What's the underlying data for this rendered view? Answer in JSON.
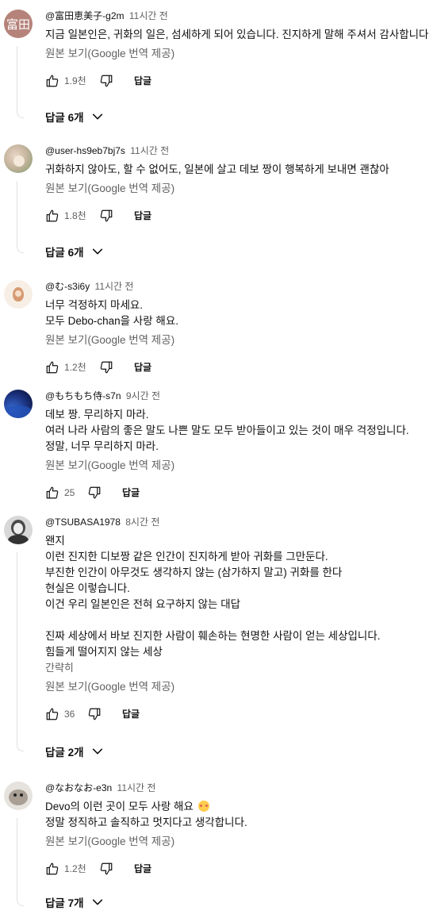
{
  "icons": {
    "like": "thumb-up-icon",
    "dislike": "thumb-down-icon",
    "chevron": "chevron-down-icon"
  },
  "colors": {
    "text": "#0f0f0f",
    "secondary": "#606060",
    "thread_line": "#e0e0e0"
  },
  "comments": [
    {
      "author": "@富田恵美子-g2m",
      "time": "11시간 전",
      "avatar_text": "富田",
      "avatar_color": "#b5837a",
      "lines": [
        "지금 일본인은, 귀화의 일은, 섬세하게 되어 있습니다. 진지하게 말해 주셔서 감사합니다"
      ],
      "translate": "원본 보기(Google 번역 제공)",
      "likes": "1.9천",
      "reply_label": "답글",
      "replies": "답글 6개"
    },
    {
      "author": "@user-hs9eb7bj7s",
      "time": "11시간 전",
      "lines": [
        "귀화하지 않아도, 할 수 없어도, 일본에 살고 데보 짱이 행복하게 보내면 괜찮아"
      ],
      "translate": "원본 보기(Google 번역 제공)",
      "likes": "1.8천",
      "reply_label": "답글",
      "replies": "답글 6개"
    },
    {
      "author": "@む-s3i6y",
      "time": "11시간 전",
      "lines": [
        "너무 걱정하지 마세요.",
        "모두 Debo-chan을 사랑 해요."
      ],
      "translate": "원본 보기(Google 번역 제공)",
      "likes": "1.2천",
      "reply_label": "답글"
    },
    {
      "author": "@もちもち侍-s7n",
      "time": "9시간 전",
      "lines": [
        "데보 짱. 무리하지 마라.",
        "여러 나라 사람의 좋은 말도 나쁜 말도 모두 받아들이고 있는 것이 매우 걱정입니다.",
        "정말, 너무 무리하지 마라."
      ],
      "translate": "원본 보기(Google 번역 제공)",
      "likes": "25",
      "reply_label": "답글"
    },
    {
      "author": "@TSUBASA1978",
      "time": "8시간 전",
      "lines": [
        "왠지",
        "이런 진지한 디보짱 같은 인간이 진지하게 받아 귀화를 그만둔다.",
        "부진한 인간이 아무것도 생각하지 않는 (삼가하지 말고) 귀화를 한다",
        "현실은 이렇습니다.",
        "이건 우리 일본인은 전혀 요구하지 않는 대답",
        "",
        "진짜 세상에서 바보 진지한 사람이 훼손하는 현명한 사람이 얻는 세상입니다.",
        "힘들게 떨어지지 않는 세상"
      ],
      "more": "간략히",
      "translate": "원본 보기(Google 번역 제공)",
      "likes": "36",
      "reply_label": "답글",
      "replies": "답글 2개"
    },
    {
      "author": "@なおなお-e3n",
      "time": "11시간 전",
      "lines": [
        "Devo의 이런 곳이 모두 사랑 해요",
        "정말 정직하고 솔직하고 멋지다고 생각합니다."
      ],
      "translate": "원본 보기(Google 번역 제공)",
      "likes": "1.2천",
      "reply_label": "답글",
      "replies": "답글 7개"
    }
  ]
}
